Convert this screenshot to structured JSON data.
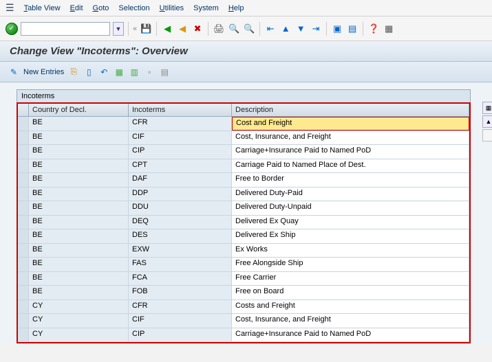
{
  "menu": {
    "items": [
      "Table View",
      "Edit",
      "Goto",
      "Selection",
      "Utilities",
      "System",
      "Help"
    ]
  },
  "title": "Change View \"Incoterms\": Overview",
  "subbar": {
    "new_entries": "New Entries"
  },
  "panel_label": "Incoterms",
  "columns": {
    "c1": "Country of Decl.",
    "c2": "Incoterms",
    "c3": "Description"
  },
  "rows": [
    {
      "c": "BE",
      "i": "CFR",
      "d": "Cost and Freight"
    },
    {
      "c": "BE",
      "i": "CIF",
      "d": "Cost, Insurance, and Freight"
    },
    {
      "c": "BE",
      "i": "CIP",
      "d": "Carriage+Insurance Paid to Named PoD"
    },
    {
      "c": "BE",
      "i": "CPT",
      "d": "Carriage Paid to Named Place of Dest."
    },
    {
      "c": "BE",
      "i": "DAF",
      "d": "Free to Border"
    },
    {
      "c": "BE",
      "i": "DDP",
      "d": "Delivered Duty-Paid"
    },
    {
      "c": "BE",
      "i": "DDU",
      "d": "Delivered Duty-Unpaid"
    },
    {
      "c": "BE",
      "i": "DEQ",
      "d": "Delivered Ex Quay"
    },
    {
      "c": "BE",
      "i": "DES",
      "d": "Delivered Ex Ship"
    },
    {
      "c": "BE",
      "i": "EXW",
      "d": "Ex Works"
    },
    {
      "c": "BE",
      "i": "FAS",
      "d": "Free Alongside Ship"
    },
    {
      "c": "BE",
      "i": "FCA",
      "d": "Free Carrier"
    },
    {
      "c": "BE",
      "i": "FOB",
      "d": "Free on Board"
    },
    {
      "c": "CY",
      "i": "CFR",
      "d": "Costs and Freight"
    },
    {
      "c": "CY",
      "i": "CIF",
      "d": "Cost, Insurance, and Freight"
    },
    {
      "c": "CY",
      "i": "CIP",
      "d": "Carriage+Insurance Paid to Named PoD"
    }
  ]
}
